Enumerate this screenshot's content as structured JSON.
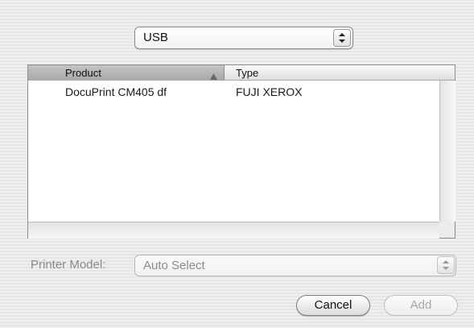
{
  "connection": {
    "selected": "USB",
    "icon": "updown-arrows-icon"
  },
  "list": {
    "columns": {
      "product": "Product",
      "type": "Type",
      "sort_icon": "sort-ascending-icon"
    },
    "rows": [
      {
        "product": "DocuPrint CM405 df",
        "type": "FUJI XEROX"
      }
    ]
  },
  "printer_model": {
    "label": "Printer Model:",
    "value": "Auto Select",
    "enabled": false
  },
  "buttons": {
    "cancel": "Cancel",
    "add": "Add",
    "add_enabled": false
  }
}
